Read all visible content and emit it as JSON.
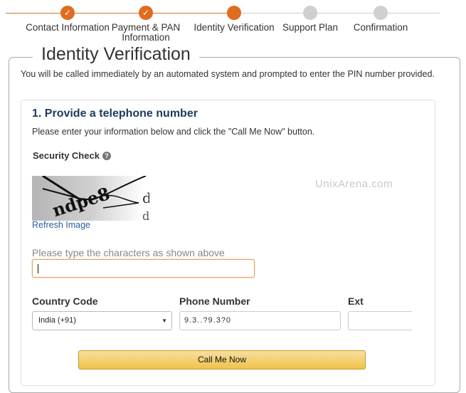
{
  "progress": {
    "steps": [
      {
        "label": "Contact Information",
        "state": "done",
        "icon": "check-icon"
      },
      {
        "label": "Payment & PAN Information",
        "state": "done",
        "icon": "check-icon"
      },
      {
        "label": "Identity Verification",
        "state": "active"
      },
      {
        "label": "Support Plan",
        "state": "todo"
      },
      {
        "label": "Confirmation",
        "state": "todo"
      }
    ],
    "check_glyph": "✓",
    "accent_color": "#df6c1f"
  },
  "page": {
    "title": "Identity Verification",
    "intro": "You will be called immediately by an automated system and prompted to enter the PIN number provided."
  },
  "section": {
    "title": "1. Provide a telephone number",
    "description": "Please enter your information below and click the \"Call Me Now\" button.",
    "security_check_label": "Security Check",
    "help_glyph": "?",
    "captcha_text": "ndpe8d",
    "refresh_link": "Refresh Image",
    "captcha_prompt": "Please type the characters as shown above",
    "captcha_value": ""
  },
  "watermark": "UnixArena.com",
  "phone_form": {
    "country_label": "Country Code",
    "country_value": "India (+91)",
    "phone_label": "Phone Number",
    "phone_value": "9.3..?9.3?0",
    "ext_label": "Ext",
    "ext_value": ""
  },
  "actions": {
    "call_button": "Call Me Now"
  }
}
